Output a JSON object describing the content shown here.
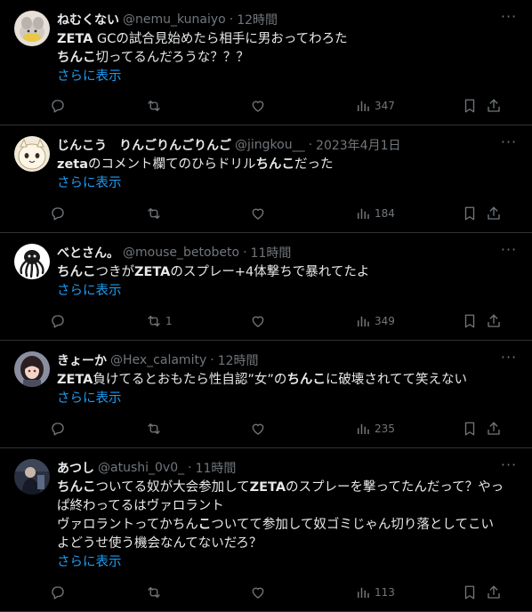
{
  "tweets": [
    {
      "name": "ねむくない",
      "handle": "@nemu_kunaiyo",
      "time": "12時間",
      "lines": [
        [
          {
            "t": "ZETA",
            "b": true
          },
          {
            "t": " GCの試合見始めたら相手に男おってわろた"
          }
        ],
        [
          {
            "t": "ちんこ",
            "b": true
          },
          {
            "t": "切ってるんだろうな？？？"
          }
        ]
      ],
      "show_more": "さらに表示",
      "retweets": "",
      "views": "347",
      "avatar": {
        "style": "gray-mascot",
        "bg": "#e6e0d8"
      }
    },
    {
      "name": "じんこう　りんごりんごりんご",
      "handle": "@jingkou__",
      "time": "2023年4月1日",
      "lines": [
        [
          {
            "t": "zeta",
            "b": true
          },
          {
            "t": "のコメント欄てのひらドリル"
          },
          {
            "t": "ちんこ",
            "b": true
          },
          {
            "t": "だった"
          }
        ]
      ],
      "show_more": "さらに表示",
      "retweets": "",
      "views": "184",
      "avatar": {
        "style": "cream-creature",
        "bg": "#f2ead8"
      }
    },
    {
      "name": "べとさん。",
      "handle": "@mouse_betobeto",
      "time": "11時間",
      "lines": [
        [
          {
            "t": "ちんこ",
            "b": true
          },
          {
            "t": "つきが"
          },
          {
            "t": "ZETA",
            "b": true
          },
          {
            "t": "のスプレー+4体撃ちで暴れてたよ"
          }
        ]
      ],
      "show_more": "さらに表示",
      "retweets": "1",
      "views": "349",
      "avatar": {
        "style": "octopus",
        "bg": "#ffffff"
      }
    },
    {
      "name": "きょーか",
      "handle": "@Hex_calamity",
      "time": "12時間",
      "lines": [
        [
          {
            "t": "ZETA",
            "b": true
          },
          {
            "t": "負けてるとおもたら性自認”女”の"
          },
          {
            "t": "ちんこ",
            "b": true
          },
          {
            "t": "に破壊されてて笑えない"
          }
        ]
      ],
      "show_more": "さらに表示",
      "retweets": "",
      "views": "235",
      "avatar": {
        "style": "anime-girl",
        "bg": "#8a8fa0"
      }
    },
    {
      "name": "あつし",
      "handle": "@atushi_0v0_",
      "time": "11時間",
      "lines": [
        [
          {
            "t": "ちんこ",
            "b": true
          },
          {
            "t": "ついてる奴が大会参加して"
          },
          {
            "t": "ZETA",
            "b": true
          },
          {
            "t": "のスプレーを撃ってたんだって？やっ"
          }
        ],
        [
          {
            "t": "ぱ終わってるはヴァロラント"
          }
        ],
        [
          {
            "t": "ヴァロラントってかちん"
          },
          {
            "t": "こ",
            "b": true
          },
          {
            "t": "ついてて参加して奴ゴミじゃん切り落としてこい"
          }
        ],
        [
          {
            "t": "よどうせ使う機会なんてないだろ？"
          }
        ]
      ],
      "show_more": "さらに表示",
      "retweets": "",
      "views": "113",
      "avatar": {
        "style": "dark-figure",
        "bg": "#2a3040"
      }
    }
  ],
  "icons": {
    "reply": "reply-icon",
    "retweet": "retweet-icon",
    "like": "like-icon",
    "views": "views-icon",
    "bookmark": "bookmark-icon",
    "share": "share-icon",
    "more": "more-icon"
  }
}
